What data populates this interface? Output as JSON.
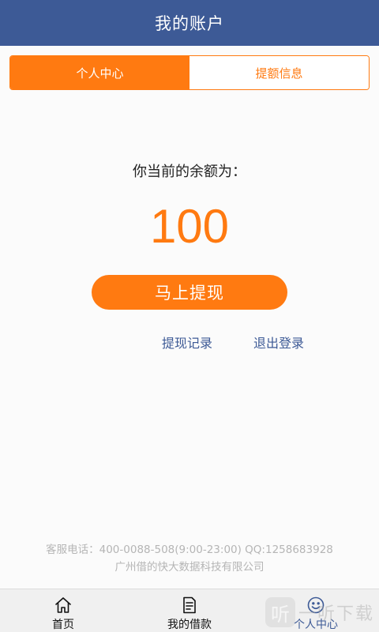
{
  "header": {
    "title": "我的账户"
  },
  "tabs": [
    {
      "label": "个人中心",
      "active": true
    },
    {
      "label": "提额信息",
      "active": false
    }
  ],
  "balance": {
    "label": "你当前的余额为：",
    "value": "100"
  },
  "actions": {
    "withdraw_label": "马上提现",
    "records_label": "提现记录",
    "logout_label": "退出登录"
  },
  "footer": {
    "line1": "客服电话：400-0088-508(9:00-23:00) QQ:1258683928",
    "line2": "广州借的快大数据科技有限公司"
  },
  "bottom_nav": [
    {
      "label": "首页",
      "icon": "home-icon",
      "active": false
    },
    {
      "label": "我的借款",
      "icon": "document-icon",
      "active": false
    },
    {
      "label": "个人中心",
      "icon": "smiley-icon",
      "active": true
    }
  ],
  "watermark": {
    "badge": "听",
    "text": "一听下载"
  },
  "colors": {
    "header_bg": "#3d5a96",
    "accent": "#ff7a11",
    "link": "#3d5a96"
  }
}
